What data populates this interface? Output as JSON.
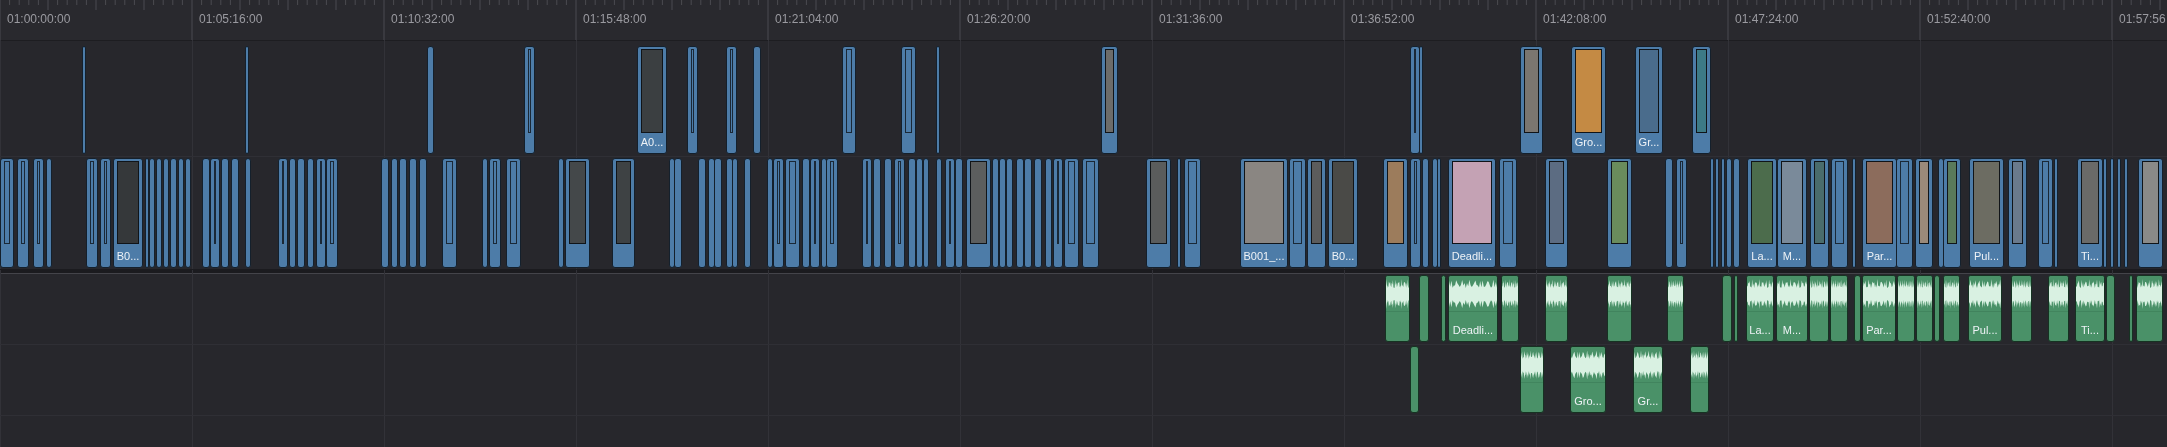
{
  "ruler": {
    "timecodes": [
      "01:00:00:00",
      "01:05:16:00",
      "01:10:32:00",
      "01:15:48:00",
      "01:21:04:00",
      "01:26:20:00",
      "01:31:36:00",
      "01:36:52:00",
      "01:42:08:00",
      "01:47:24:00",
      "01:52:40:00",
      "01:57:56"
    ]
  },
  "video_tracks": [
    {
      "clip_labels": [
        "A0...",
        "Gro...",
        "Gr..."
      ]
    },
    {
      "clip_labels": [
        "B0...",
        "B001_...",
        "B0...",
        "Deadli...",
        "La...",
        "M...",
        "Par...",
        "Pul...",
        "Ti..."
      ]
    }
  ],
  "audio_tracks": [
    {
      "clip_labels": [
        "Deadli...",
        "La...",
        "M...",
        "Par...",
        "Pul...",
        "Ti..."
      ]
    },
    {
      "clip_labels": [
        "Gro...",
        "Gr..."
      ]
    }
  ]
}
